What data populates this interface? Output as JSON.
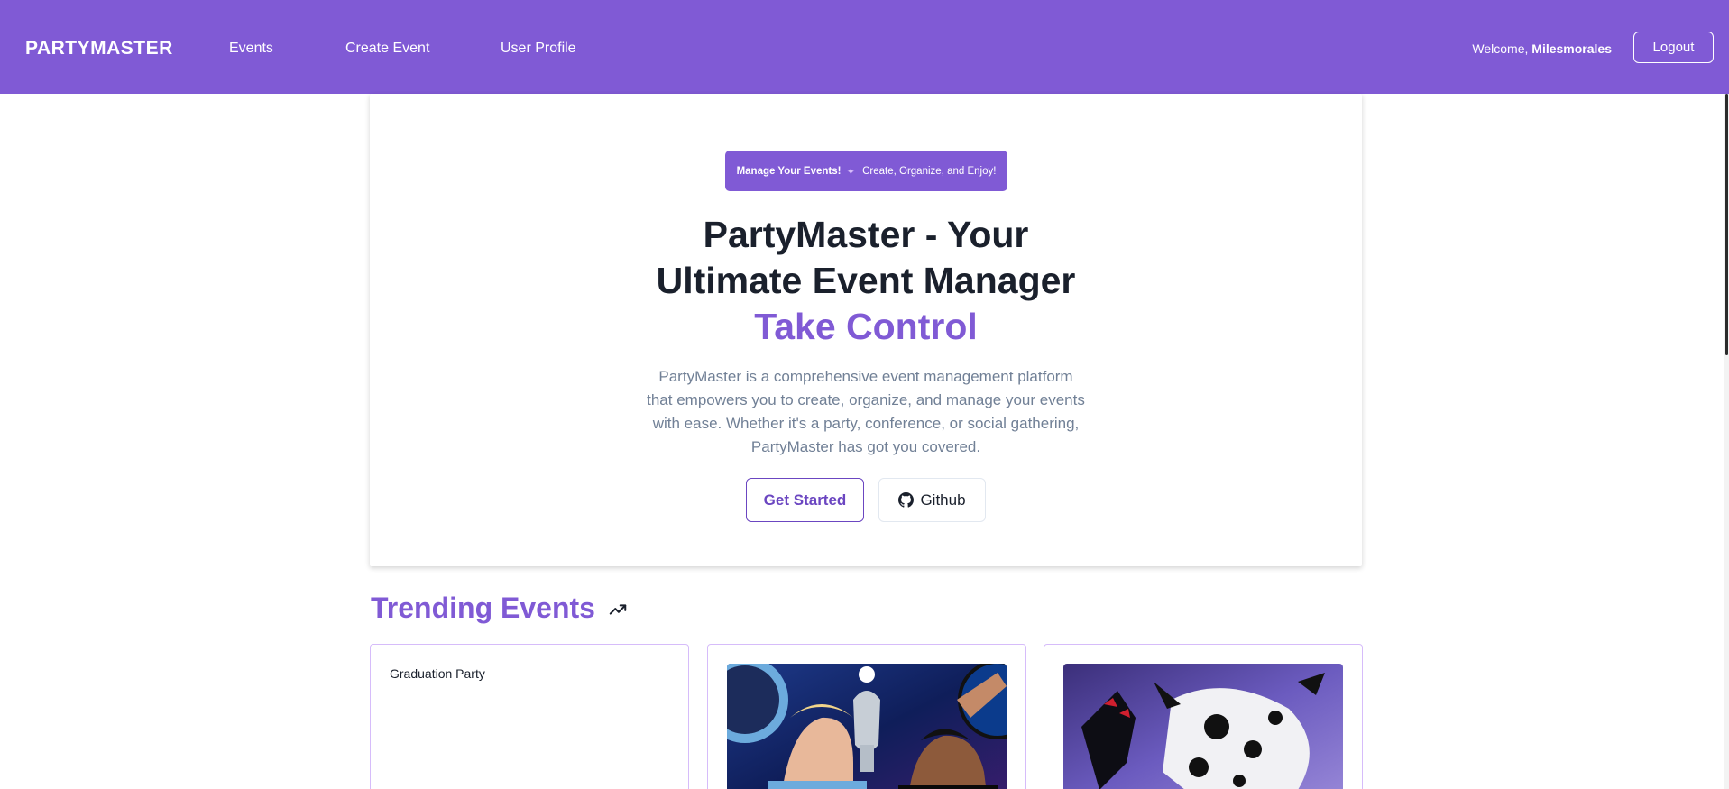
{
  "navbar": {
    "brand": "PARTYMASTER",
    "links": [
      "Events",
      "Create Event",
      "User Profile"
    ],
    "welcome_prefix": "Welcome,",
    "username": "Milesmorales",
    "logout_label": "Logout",
    "bg_color": "#805ad5"
  },
  "hero": {
    "badge_strong": "Manage Your Events!",
    "badge_icon": "sparkles-icon",
    "badge_text": "Create, Organize, and Enjoy!",
    "title_line1": "PartyMaster - Your",
    "title_line2": "Ultimate Event Manager",
    "highlight": "Take Control",
    "description": "PartyMaster is a comprehensive event management platform that empowers you to create, organize, and manage your events with ease. Whether it's a party, conference, or social gathering, PartyMaster has got you covered.",
    "primary_button": "Get Started",
    "secondary_button": "Github",
    "secondary_icon": "github-icon"
  },
  "trending": {
    "title": "Trending Events",
    "icon": "trending-up-icon",
    "events": [
      {
        "title": "Graduation Party",
        "image": ""
      },
      {
        "title": "",
        "image": "champions-league-poster"
      },
      {
        "title": "",
        "image": "spider-verse-poster"
      }
    ]
  }
}
